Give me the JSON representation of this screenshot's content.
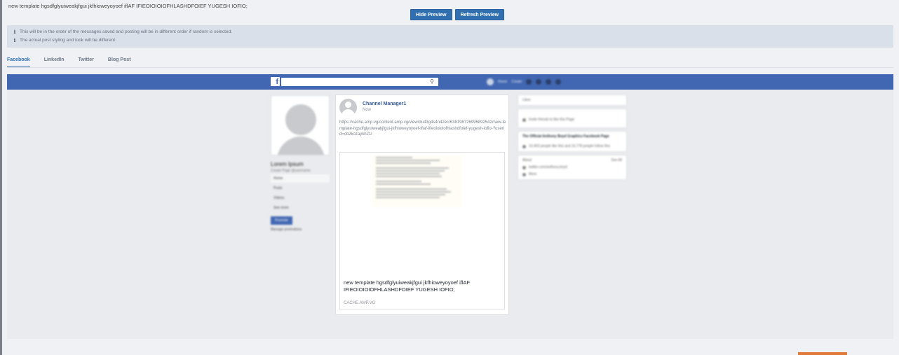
{
  "template_text": "new template hgsdfglyuiweakjfgui jkfhioweyoyoef iflAF IFIEOIOIOIOFHLASHDFOIEF YUGESH IOFIO;",
  "buttons": {
    "hide_preview": "Hide Preview",
    "refresh_preview": "Refresh Preview"
  },
  "notices": [
    "This will be in the order of the messages saved and posting will be in different order if random is selected.",
    "The actual post styling and look will be different."
  ],
  "tabs": [
    {
      "label": "Facebook",
      "active": true
    },
    {
      "label": "LinkedIn",
      "active": false
    },
    {
      "label": "Twitter",
      "active": false
    },
    {
      "label": "Blog Post",
      "active": false
    }
  ],
  "facebook": {
    "nav_items": [
      "Home",
      "Create"
    ],
    "page": {
      "name": "Lorem Ipsum",
      "sub": "Create Page @username",
      "menu": [
        "Home",
        "Posts",
        "Videos",
        "See more"
      ],
      "promote_label": "Promote",
      "manage_label": "Manage promotions"
    },
    "post": {
      "author": "Channel Manager1",
      "time": "Now",
      "url": "https://cache.amp.vg/content.amp.vg/view/du43g4s4n42ec/638198726995892542/new-template-hgsdfglyuiweakjfgui-jkfhioweyoyoef-iflaf-ifieoioioiofhlashdfoief-yugesh-iofio-?userid=cb2kozaykh21l",
      "link_title": "new template hgsdfglyuiweakjfgui jkfhioweyoyoef iflAF IFIEOIOIOIOFHLASHDFOIEF YUGESH IOFIO;",
      "link_domain": "CACHE.AMP.VG"
    },
    "right": {
      "box1": "Likes",
      "box2": "Invite friends to like this Page",
      "box3_title": "The Official Anthony Boyd Graphics Facebook Page",
      "box3_text": "10,403 people like this and 10,778 people follow this",
      "about": "About",
      "see_all": "See All",
      "about_items": [
        "twitter.com/anthony.boyd",
        "More"
      ]
    }
  },
  "colors": {
    "accent": "#2f6fb0",
    "facebook_blue": "#4267b2",
    "notice_bg": "#d9e0ea"
  }
}
